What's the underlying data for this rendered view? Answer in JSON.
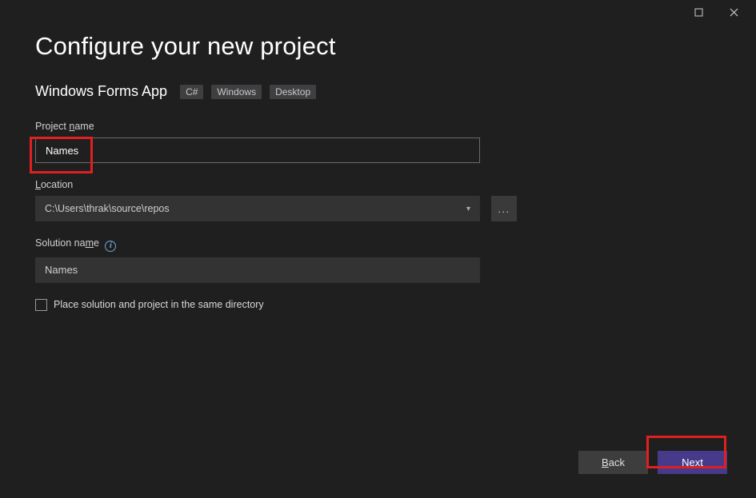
{
  "window": {
    "title": "Configure your new project",
    "subtitle": "Windows Forms App",
    "tags": [
      "C#",
      "Windows",
      "Desktop"
    ]
  },
  "fields": {
    "projectName": {
      "label": "Project name",
      "label_ul": "n",
      "value": "Names"
    },
    "location": {
      "label": "Location",
      "label_ul": "L",
      "value": "C:\\Users\\thrak\\source\\repos",
      "browse": "..."
    },
    "solutionName": {
      "label": "Solution name",
      "label_ul": "m",
      "value": "Names"
    },
    "placeSameDir": {
      "label_pre": "Place solution and project in the same ",
      "label_ul": "d",
      "label_post": "irectory",
      "checked": false
    }
  },
  "buttons": {
    "back": "Back",
    "back_ul": "B",
    "next": "Next",
    "next_ul": "N"
  },
  "icons": {
    "maximize": "☐",
    "close": "✕"
  }
}
